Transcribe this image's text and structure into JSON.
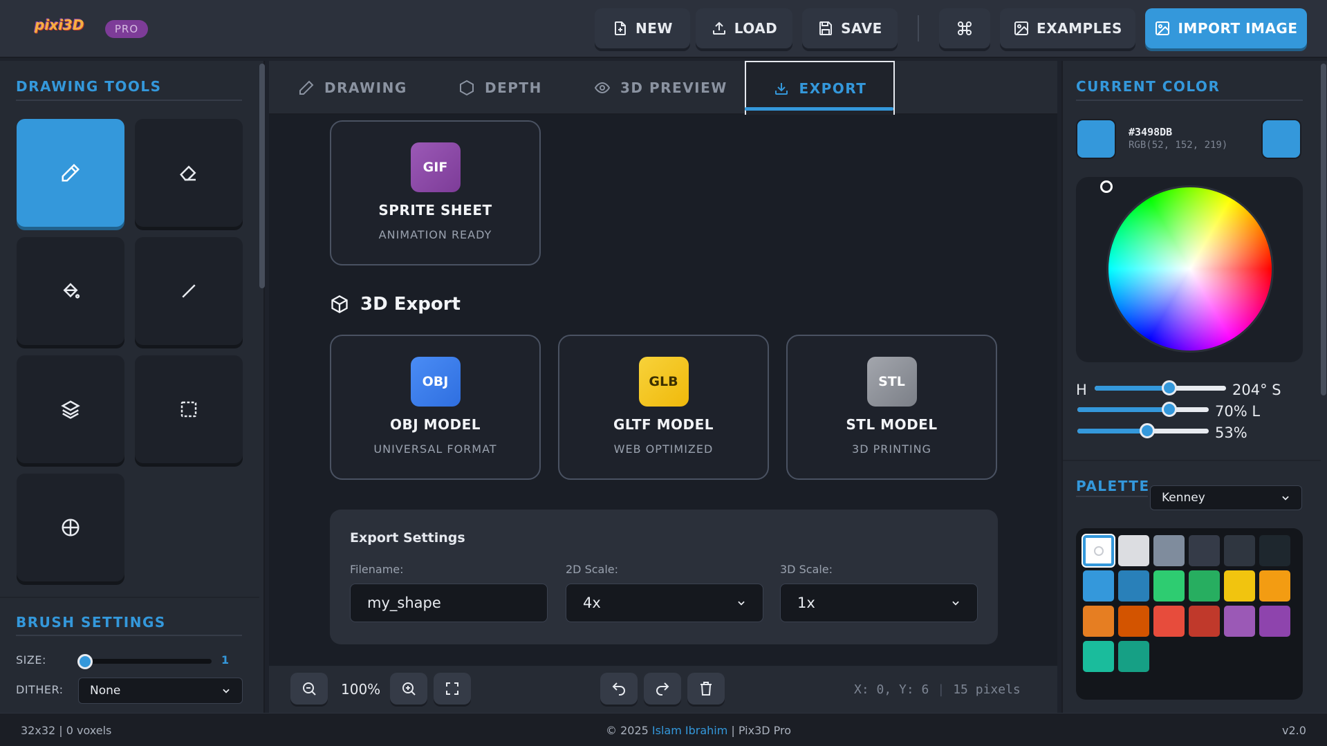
{
  "header": {
    "logo_text": "pixi3D",
    "pro_badge": "PRO",
    "buttons": {
      "new": "NEW",
      "load": "LOAD",
      "save": "SAVE",
      "examples": "EXAMPLES",
      "import_image": "IMPORT IMAGE"
    },
    "accent_color": "#3498db"
  },
  "left_sidebar": {
    "drawing_tools_title": "DRAWING TOOLS",
    "tools": [
      {
        "icon": "pencil-icon",
        "active": true
      },
      {
        "icon": "eraser-icon",
        "active": false
      },
      {
        "icon": "paint-bucket-icon",
        "active": false
      },
      {
        "icon": "line-icon",
        "active": false
      },
      {
        "icon": "layers-icon",
        "active": false
      },
      {
        "icon": "select-rect-icon",
        "active": false
      },
      {
        "icon": "crosshair-icon",
        "active": false
      }
    ],
    "brush_settings_title": "BRUSH SETTINGS",
    "size_label": "SIZE:",
    "size_value": "1",
    "dither_label": "DITHER:",
    "dither_value": "None"
  },
  "tabs": [
    {
      "label": "DRAWING",
      "icon": "pencil-icon"
    },
    {
      "label": "DEPTH",
      "icon": "hexagon-icon"
    },
    {
      "label": "3D PREVIEW",
      "icon": "eye-icon"
    },
    {
      "label": "EXPORT",
      "icon": "download-icon",
      "active": true
    }
  ],
  "export": {
    "sprite_card": {
      "badge": "GIF",
      "title": "SPRITE SHEET",
      "subtitle": "ANIMATION READY"
    },
    "section_3d_title": "3D Export",
    "cards": [
      {
        "badge": "OBJ",
        "title": "OBJ MODEL",
        "subtitle": "UNIVERSAL FORMAT",
        "badge_color": "#3b82f6"
      },
      {
        "badge": "GLB",
        "title": "GLTF MODEL",
        "subtitle": "WEB OPTIMIZED",
        "badge_color": "#f5c518"
      },
      {
        "badge": "STL",
        "title": "STL MODEL",
        "subtitle": "3D PRINTING",
        "badge_color": "#8a8d94"
      }
    ],
    "settings": {
      "title": "Export Settings",
      "filename_label": "Filename:",
      "filename_value": "my_shape",
      "scale2d_label": "2D Scale:",
      "scale2d_value": "4x",
      "scale3d_label": "3D Scale:",
      "scale3d_value": "1x"
    }
  },
  "bottom_bar": {
    "zoom": "100%",
    "coords": "X: 0, Y: 6",
    "separator": "|",
    "pixels": "15 pixels"
  },
  "right_sidebar": {
    "current_color_title": "CURRENT COLOR",
    "hex": "#3498DB",
    "rgb": "RGB(52, 152, 219)",
    "h_label": "H",
    "h_value": "204° S",
    "s_value": "70% L",
    "l_value": "53%",
    "h_fraction": 0.567,
    "s_fraction": 0.7,
    "l_fraction": 0.53,
    "palette_title": "PALETTE",
    "palette_name": "Kenney",
    "palette_colors": [
      "#ffffff",
      "#dcdde1",
      "#7f8c9d",
      "#353b48",
      "#2f3640",
      "#1e272e",
      "#3498db",
      "#2980b9",
      "#2ecc71",
      "#27ae60",
      "#f1c40f",
      "#f39c12",
      "#e67e22",
      "#d35400",
      "#e74c3c",
      "#c0392b",
      "#9b59b6",
      "#8e44ad",
      "#1abc9c",
      "#16a085"
    ]
  },
  "footer": {
    "left": "32x32 | 0 voxels",
    "copyright_prefix": "© 2025 ",
    "author": "Islam Ibrahim",
    "copyright_suffix": " | Pix3D Pro",
    "version": "v2.0"
  }
}
